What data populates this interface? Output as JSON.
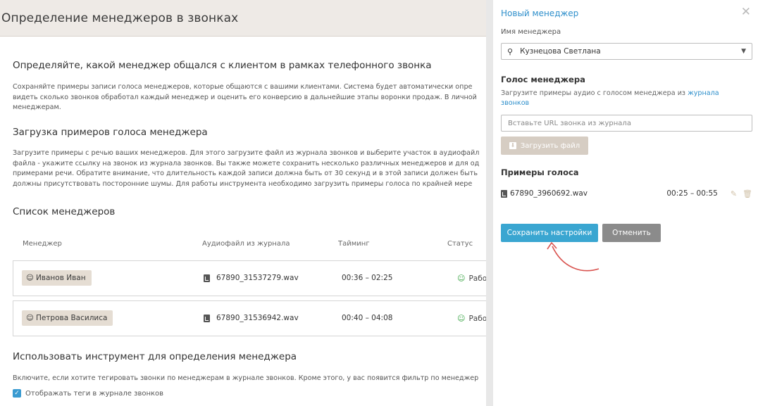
{
  "header": {
    "title": "Определение менеджеров в звонках"
  },
  "section1": {
    "title": "Определяйте, какой менеджер общался с клиентом в рамках телефонного звонка",
    "lines": [
      "Сохраняйте примеры записи голоса менеджеров, которые общаются с вашими клиентами. Система будет автоматически опре",
      "видеть сколько звонков обработал каждый менеджер и оценить его конверсию в дальнейшие этапы воронки продаж. В личной",
      "менеджерам."
    ]
  },
  "section2": {
    "title": "Загрузка примеров голоса менеджера",
    "lines": [
      "Загрузите примеры с речью ваших менеджеров. Для этого загрузите файл из журнала звонков и выберите участок в аудиофайл",
      "файла - укажите ссылку на звонок из журнала звонков. Вы также можете сохранить несколько различных менеджеров и для од",
      "примерами речи. Обратите внимание, что длительность каждой записи должна быть от 30 секунд и в этой записи должен быть",
      "должны присутствовать посторонние шумы. Для работы инструмента необходимо загрузить примеры голоса по крайней мере"
    ]
  },
  "section3": {
    "title": "Список менеджеров",
    "columns": [
      "Менеджер",
      "Аудиофайл из журнала",
      "Тайминг",
      "Статус"
    ],
    "rows": [
      {
        "manager": "Иванов Иван",
        "file": "67890_31537279.wav",
        "timing": "00:36 – 02:25",
        "status": "Работа"
      },
      {
        "manager": "Петрова Василиса",
        "file": "67890_31536942.wav",
        "timing": "00:40 – 04:08",
        "status": "Работа"
      }
    ]
  },
  "section4": {
    "title": "Использовать инструмент для определения менеджера",
    "text": "Включите, если хотите тегировать звонки по менеджерам в журнале звонков. Кроме этого, у вас появится фильтр по менеджер",
    "checkbox_label": "Отображать теги в журнале звонков"
  },
  "panel": {
    "title": "Новый менеджер",
    "name_label": "Имя менеджера",
    "name_value": "Кузнецова Светлана",
    "voice_title": "Голос менеджера",
    "voice_hint": "Загрузите примеры аудио с голосом менеджера из",
    "voice_hint_link": "журнала звонков",
    "url_placeholder": "Вставьте URL звонка из журнала",
    "upload_label": "Загрузить файл",
    "samples_title": "Примеры голоса",
    "sample": {
      "file": "67890_3960692.wav",
      "timing": "00:25 – 00:55"
    },
    "save_label": "Сохранить настройки",
    "cancel_label": "Отменить"
  },
  "colors": {
    "accent": "#3aa6d1",
    "link": "#2e8fcb",
    "tag_bg": "#e5ddd3",
    "status_green": "#3fa84a",
    "arrow": "#d9534f"
  }
}
